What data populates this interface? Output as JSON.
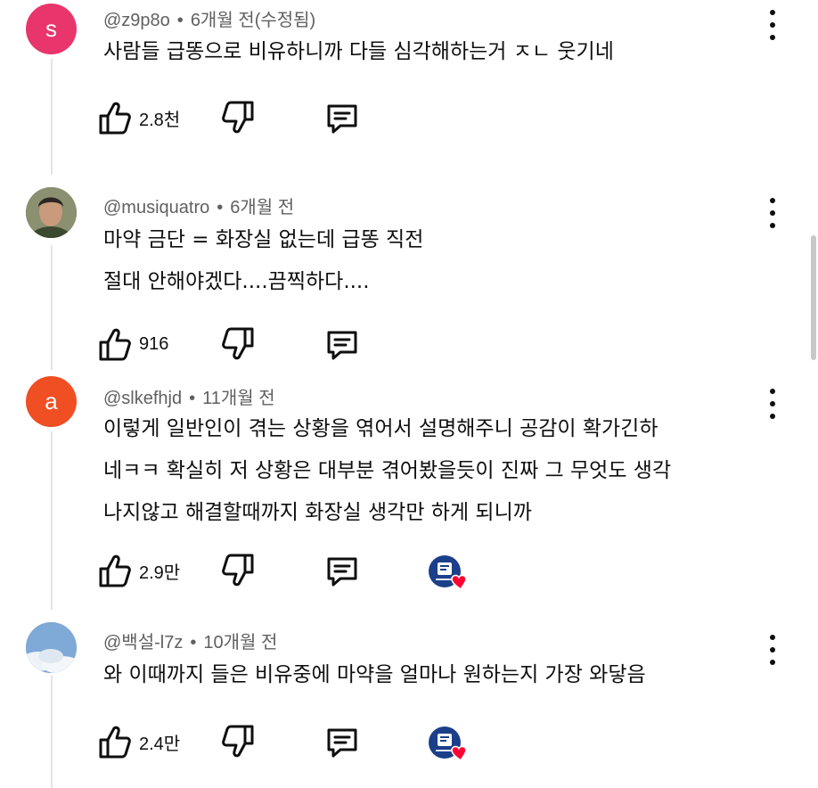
{
  "comments": [
    {
      "avatar_letter": "s",
      "avatar_color": "#e8356b",
      "handle": "@z9p8o",
      "time": "6개월 전(수정됨)",
      "lines": [
        "사람들 급똥으로 비유하니까 다들 심각해하는거 ㅈㄴ 웃기네"
      ],
      "likes": "2.8천",
      "creator_hearted": false
    },
    {
      "avatar_letter": "",
      "avatar_color": "#6b6a52",
      "handle": "@musiquatro",
      "time": "6개월 전",
      "lines": [
        "마약 금단 = 화장실 없는데 급똥 직전",
        "절대 안해야겠다....끔찍하다...."
      ],
      "likes": "916",
      "creator_hearted": false
    },
    {
      "avatar_letter": "a",
      "avatar_color": "#f04e23",
      "handle": "@slkefhjd",
      "time": "11개월 전",
      "lines": [
        "이렇게 일반인이 겪는 상황을 엮어서 설명해주니 공감이 확가긴하",
        "네ㅋㅋ 확실히 저 상황은 대부분 겪어봤을듯이 진짜 그 무엇도 생각",
        "나지않고 해결할때까지 화장실 생각만 하게 되니까"
      ],
      "likes": "2.9만",
      "creator_hearted": true
    },
    {
      "avatar_letter": "",
      "avatar_color": "#8fb5dd",
      "handle": "@백설-l7z",
      "time": "10개월 전",
      "lines": [
        "와 이때까지 들은 비유중에 마약을 얼마나 원하는지 가장 와닿음"
      ],
      "likes": "2.4만",
      "creator_hearted": true
    }
  ],
  "icons": {
    "like": "thumbs-up-icon",
    "dislike": "thumbs-down-icon",
    "reply": "reply-icon",
    "menu": "more-vert-icon",
    "heart": "creator-heart-icon"
  },
  "colors": {
    "heart": "#ff0033",
    "text": "#0f0f0f",
    "meta": "#606060"
  }
}
